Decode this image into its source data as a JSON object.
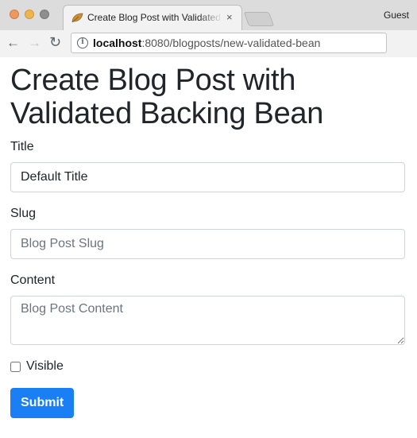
{
  "browser": {
    "tab_title": "Create Blog Post with Validated Backing Bean",
    "tab_close": "×",
    "profile": "Guest",
    "url_host": "localhost",
    "url_path": ":8080/blogposts/new-validated-bean",
    "back_icon": "arrow-left-icon",
    "forward_icon": "arrow-right-icon",
    "reload_icon": "reload-icon"
  },
  "page": {
    "title": "Create Blog Post with Validated Backing Bean"
  },
  "form": {
    "title_label": "Title",
    "title_value": "Default Title",
    "slug_label": "Slug",
    "slug_placeholder": "Blog Post Slug",
    "content_label": "Content",
    "content_placeholder": "Blog Post Content",
    "visible_label": "Visible",
    "visible_checked": false,
    "submit_label": "Submit"
  },
  "colors": {
    "primary": "#1a7ff5",
    "text": "#212529",
    "border": "#ced4da"
  }
}
